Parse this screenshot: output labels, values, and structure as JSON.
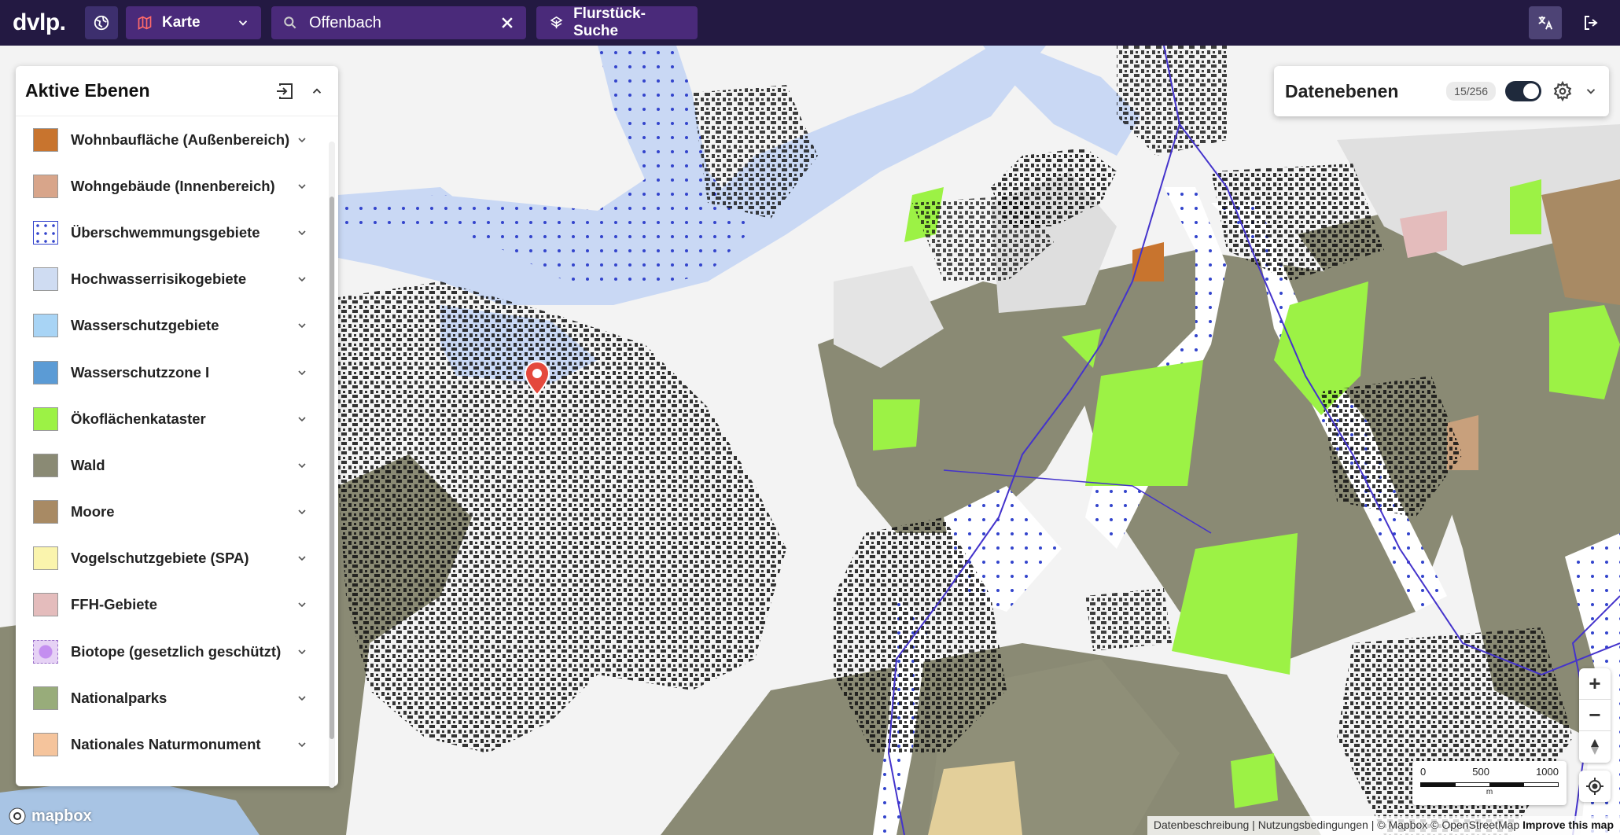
{
  "topbar": {
    "logo": "dvlp.",
    "map_toggle_label": "Karte",
    "search_value": "Offenbach",
    "parcel_search_label": "Flurstück-Suche"
  },
  "left_panel": {
    "title": "Aktive Ebenen",
    "layers": [
      {
        "label": "Wohnbaufläche (Außenbereich)",
        "color": "#c8742e"
      },
      {
        "label": "Wohngebäude (Innenbereich)",
        "color": "#d8a58a"
      },
      {
        "label": "Überschwemmungsgebiete",
        "color": "#ffffff"
      },
      {
        "label": "Hochwasserrisikogebiete",
        "color": "#cfdcf2"
      },
      {
        "label": "Wasserschutzgebiete",
        "color": "#a8d4f5"
      },
      {
        "label": "Wasserschutzzone I",
        "color": "#5b9bd5"
      },
      {
        "label": "Ökoflächenkataster",
        "color": "#9cf245"
      },
      {
        "label": "Wald",
        "color": "#8a8a74"
      },
      {
        "label": "Moore",
        "color": "#a88a64"
      },
      {
        "label": "Vogelschutzgebiete (SPA)",
        "color": "#faf4ad"
      },
      {
        "label": "FFH-Gebiete",
        "color": "#e4bcbc"
      },
      {
        "label": "Biotope (gesetzlich geschützt)",
        "color": "#e6d2f5"
      },
      {
        "label": "Nationalparks",
        "color": "#98ac7a"
      },
      {
        "label": "Nationales Naturmonument",
        "color": "#f5c49c"
      }
    ]
  },
  "right_panel": {
    "title": "Datenebenen",
    "count_badge": "15/256",
    "toggle_on": true
  },
  "scale": {
    "ticks": [
      "0",
      "500",
      "1000"
    ],
    "unit": "m"
  },
  "attribution": {
    "text": "Datenbeschreibung | Nutzungsbedingungen | © Mapbox © OpenStreetMap",
    "improve": "Improve this map"
  },
  "mapbox_logo": "mapbox",
  "colors": {
    "topbar": "#231942",
    "button": "#4a2a7a",
    "forest": "#8a8a74",
    "green": "#9cf245",
    "water": "#c9d8f4",
    "buildings": "#111111",
    "pin": "#e4483c"
  }
}
